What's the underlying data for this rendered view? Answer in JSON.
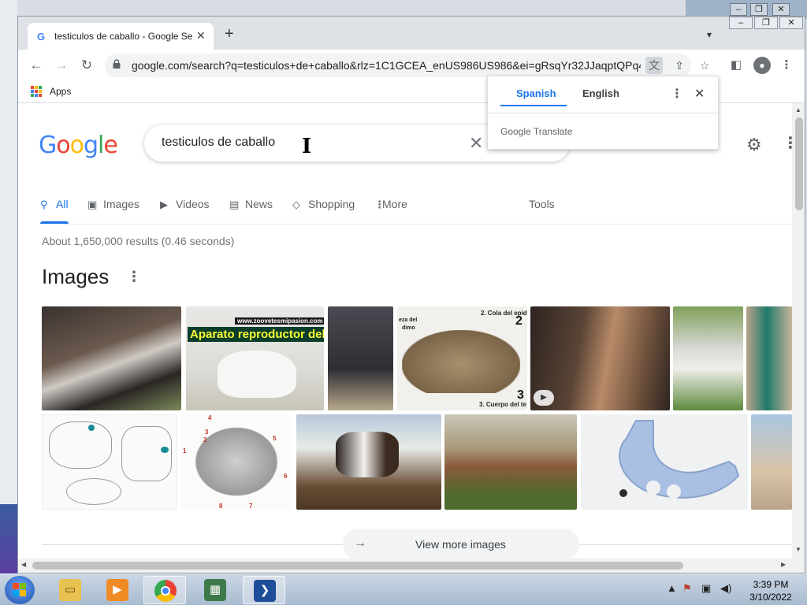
{
  "browser": {
    "tab_title": "testiculos de caballo - Google Se",
    "tab_favicon": "G",
    "url": "google.com/search?q=testiculos+de+caballo&rlz=1C1GCEA_enUS986US986&ei=gRsqYr32JJaqptQPq4...",
    "bookmarks": {
      "apps_label": "Apps"
    }
  },
  "search": {
    "query": "testiculos de caballo",
    "tabs": [
      {
        "label": "All"
      },
      {
        "label": "Images"
      },
      {
        "label": "Videos"
      },
      {
        "label": "News"
      },
      {
        "label": "Shopping"
      },
      {
        "label": "More"
      }
    ],
    "tools_label": "Tools",
    "result_stats": "About 1,650,000 results (0.46 seconds)",
    "images_heading": "Images",
    "thumbnail_captions": [
      "www.zoovetesmipasion.com",
      "Aparato reproductor del c",
      "eza del",
      "dimo",
      "2. Cola del epid",
      "2",
      "3. Cuerpo del te",
      "3",
      "4",
      "3",
      "2",
      "1",
      "5",
      "6",
      "8",
      "7"
    ],
    "view_more_label": "View more images"
  },
  "translate_popup": {
    "source_lang": "Spanish",
    "target_lang": "English",
    "brand": "Google Translate"
  },
  "taskbar": {
    "time": "3:39 PM",
    "date": "3/10/2022"
  },
  "colors": {
    "accent": "#1a73e8",
    "google_blue": "#4285f4",
    "google_red": "#ea4335",
    "google_yellow": "#fbbc05",
    "google_green": "#34a853"
  }
}
